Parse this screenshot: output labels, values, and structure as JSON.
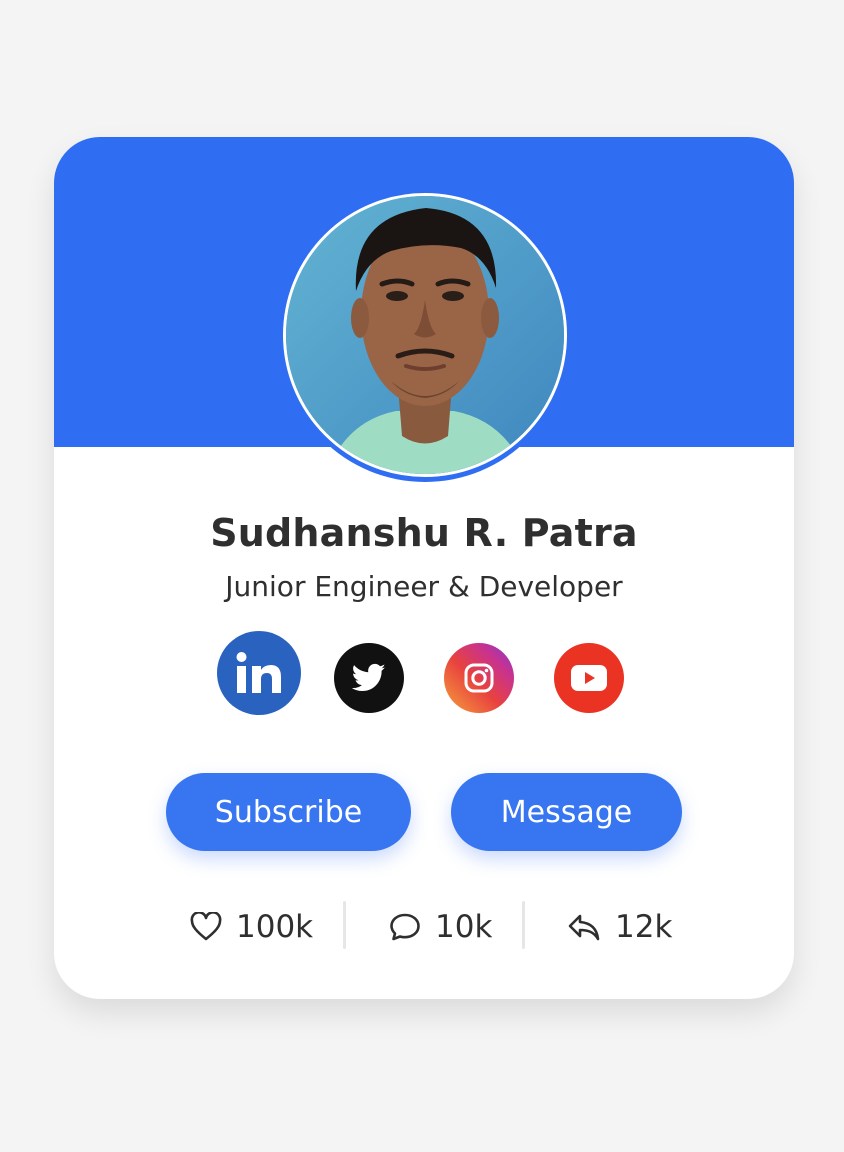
{
  "profile": {
    "name": "Sudhanshu R. Patra",
    "role": "Junior Engineer & Developer"
  },
  "social": [
    {
      "network": "LinkedIn",
      "icon": "linkedin-icon",
      "color": "#2a63bf"
    },
    {
      "network": "Twitter",
      "icon": "twitter-icon",
      "color": "#111111"
    },
    {
      "network": "Instagram",
      "icon": "instagram-icon",
      "color": "#e8423f"
    },
    {
      "network": "YouTube",
      "icon": "youtube-icon",
      "color": "#ea3323"
    }
  ],
  "actions": {
    "subscribe_label": "Subscribe",
    "message_label": "Message"
  },
  "stats": {
    "likes": "100k",
    "comments": "10k",
    "shares": "12k"
  },
  "colors": {
    "accent": "#2f6df3",
    "button": "#3775f1",
    "background": "#f4f4f4",
    "text": "#2f2f2f"
  }
}
